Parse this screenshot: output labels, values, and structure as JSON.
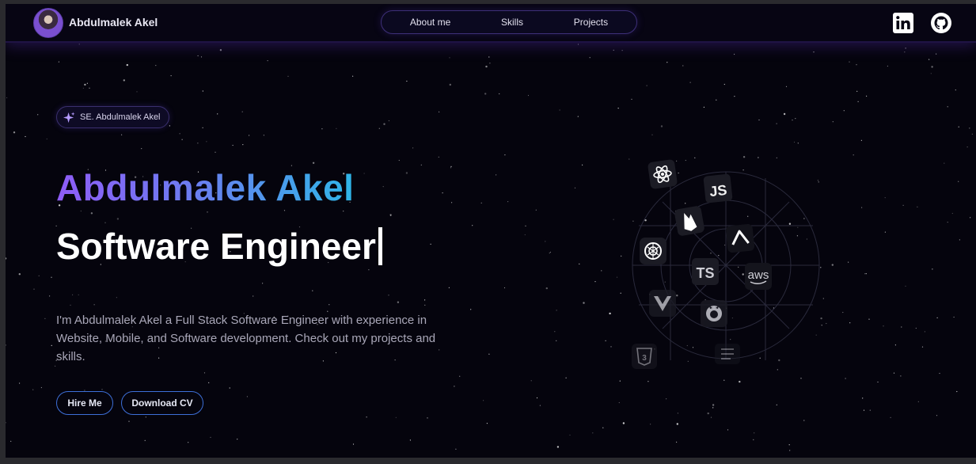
{
  "brand": {
    "name": "Abdulmalek Akel"
  },
  "nav": {
    "links": [
      "About me",
      "Skills",
      "Projects"
    ]
  },
  "social": {
    "icons": [
      "linkedin-icon",
      "github-icon"
    ]
  },
  "hero": {
    "badge": "SE. Abdulmalek Akel",
    "name": "Abdulmalek Akel",
    "role": "Software Engineer",
    "intro": "I'm Abdulmalek Akel a Full Stack Software Engineer with experience in Website, Mobile, and Software development. Check out my projects and skills.",
    "buttons": {
      "hire": "Hire Me",
      "cv": "Download CV"
    }
  },
  "tech_icons": {
    "js": "JS",
    "ts": "TS",
    "aws": "aws",
    "names": [
      "react-icon",
      "js-icon",
      "firebase-icon",
      "vercel-icon",
      "openai-icon",
      "ts-icon",
      "aws-icon",
      "vue-icon",
      "github-icon",
      "css3-icon",
      "html5-icon"
    ]
  },
  "colors": {
    "background": "#05040d",
    "gradient_start": "#8f5cf7",
    "gradient_end": "#2fb6e8",
    "button_border": "#3d6fd8",
    "nav_border": "#3d2f78"
  }
}
